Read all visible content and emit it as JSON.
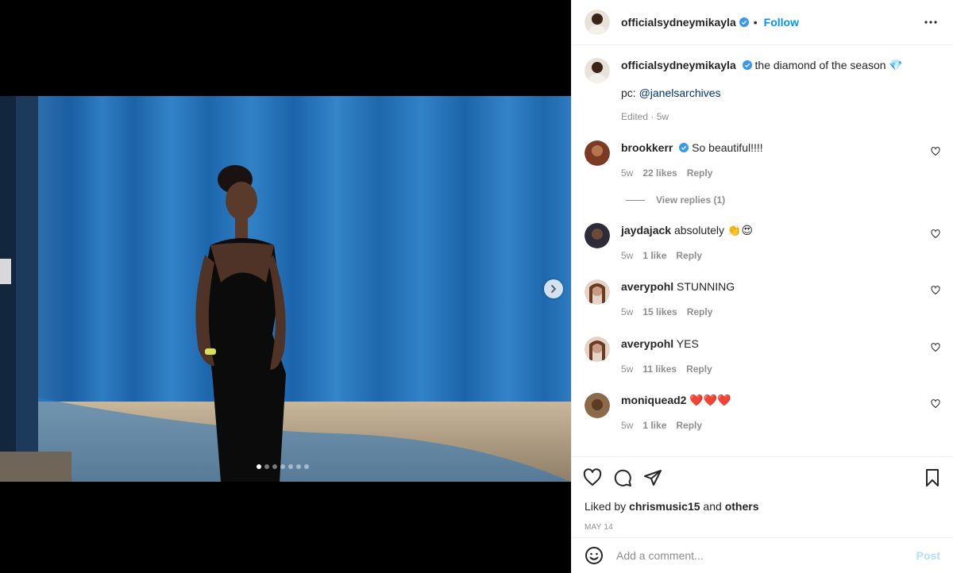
{
  "post": {
    "author": "officialsydneymikayla",
    "follow_label": "Follow",
    "dot": "•",
    "caption_text": "the diamond of the season 💎",
    "caption_line2_prefix": "pc: ",
    "caption_mention": "@janelsarchives",
    "caption_meta": "Edited · 5w",
    "carousel": {
      "total": 7,
      "active": 1
    }
  },
  "comments": [
    {
      "user": "brookkerr",
      "verified": true,
      "text": "So beautiful!!!!",
      "age": "5w",
      "likes": "22 likes",
      "reply": "Reply",
      "view_replies": "View replies (1)"
    },
    {
      "user": "jaydajack",
      "verified": false,
      "text": "absolutely 👏😍",
      "age": "5w",
      "likes": "1 like",
      "reply": "Reply"
    },
    {
      "user": "averypohl",
      "verified": false,
      "text": "STUNNING",
      "age": "5w",
      "likes": "15 likes",
      "reply": "Reply"
    },
    {
      "user": "averypohl",
      "verified": false,
      "text": "YES",
      "age": "5w",
      "likes": "11 likes",
      "reply": "Reply"
    },
    {
      "user": "moniquead2",
      "verified": false,
      "text": "❤️❤️❤️",
      "age": "5w",
      "likes": "1 like",
      "reply": "Reply"
    }
  ],
  "liked_by": {
    "prefix": "Liked by ",
    "user": "chrismusic15",
    "mid": " and ",
    "others": "others"
  },
  "date": "MAY 14",
  "composer": {
    "placeholder": "Add a comment...",
    "post_label": "Post"
  },
  "colors": {
    "accent": "#0095f6",
    "verified": "#3897f0",
    "curtain": "#1f6fb5"
  },
  "icons": [
    "more-icon",
    "verified-icon",
    "chevron-right-icon",
    "heart-icon",
    "comment-icon",
    "share-icon",
    "bookmark-icon",
    "emoji-icon"
  ]
}
